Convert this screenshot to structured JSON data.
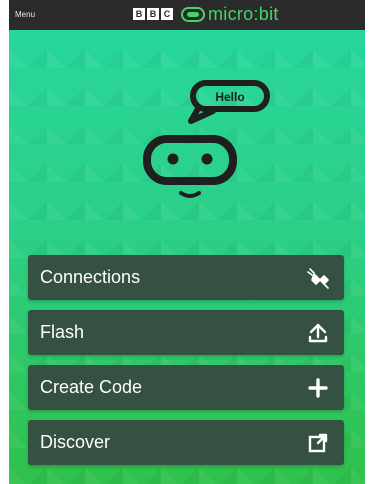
{
  "topbar": {
    "menu_label": "Menu",
    "bbc_letters": [
      "B",
      "B",
      "C"
    ],
    "brand_text": "micro:bit",
    "brand_color": "#47d36a"
  },
  "mascot": {
    "speech_text": "Hello",
    "icon": "robot-face-icon"
  },
  "menu": [
    {
      "label": "Connections",
      "icon": "plug-icon"
    },
    {
      "label": "Flash",
      "icon": "upload-icon"
    },
    {
      "label": "Create Code",
      "icon": "plus-icon"
    },
    {
      "label": "Discover",
      "icon": "external-link-icon"
    }
  ],
  "colors": {
    "background_top": "#28d69b",
    "background_bottom": "#2fc14a",
    "button_bg": "#355141",
    "topbar_bg": "#2b2b2b",
    "text": "#ffffff"
  }
}
